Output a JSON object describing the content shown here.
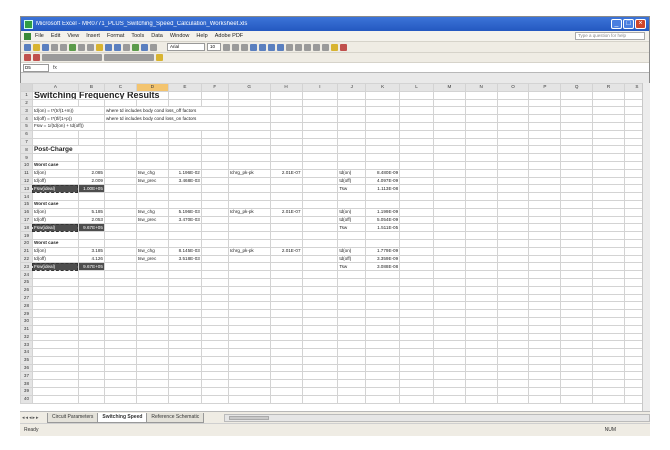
{
  "window": {
    "title": "Microsoft Excel - MR0771_PLUS_Switching_Speed_Calculation_Worksheet.xls",
    "buttons": [
      "_",
      "□",
      "×"
    ]
  },
  "menu": {
    "items": [
      "File",
      "Edit",
      "View",
      "Insert",
      "Format",
      "Tools",
      "Data",
      "Window",
      "Help",
      "Adobe PDF"
    ],
    "help_placeholder": "Type a question for help"
  },
  "toolbar": {
    "font": "Arial",
    "size": "10"
  },
  "formula_bar": {
    "cell": "D5",
    "fx": "fx",
    "value": ""
  },
  "columns": [
    "A",
    "B",
    "C",
    "D",
    "E",
    "F",
    "G",
    "H",
    "I",
    "J",
    "K",
    "L",
    "M",
    "N",
    "O",
    "P",
    "Q",
    "R",
    "S"
  ],
  "selected_column": "D",
  "sheet": {
    "title": "Switching Frequency Results",
    "notes": [
      {
        "a": "td(on) = t*(tr/(1+m))",
        "c": "where td includes body cond loss_off factors"
      },
      {
        "a": "td(off) = t*(tf/(1+p))",
        "c": "where td includes body cond loss_on factors"
      },
      {
        "a": "Fsw = 1/(td(on) + td(off))",
        "c": ""
      }
    ],
    "section": "Post-Charge",
    "groups": [
      {
        "label": "Worst case",
        "rows": [
          {
            "a": "td(on)",
            "b": "2.085",
            "d": "tsw_chg",
            "e": "1.196E-02",
            "g": "Ichrg_pk-pk",
            "h": "2.01E-07",
            "j": "td(on)",
            "k": "8.480E-09"
          },
          {
            "a": "td(off)",
            "b": "2.009",
            "d": "tsw_prec",
            "e": "3.468E-03",
            "g": "",
            "h": "",
            "j": "td(off)",
            "k": "4.097E-09"
          },
          {
            "a": "Fsw(ideal)",
            "b": "1.00E+05",
            "d": "",
            "e": "",
            "g": "",
            "h": "",
            "j": "Tsw",
            "k": "1.113E-08"
          }
        ]
      },
      {
        "label": "Worst case",
        "rows": [
          {
            "a": "td(on)",
            "b": "5.185",
            "d": "tsw_chg",
            "e": "5.196E-03",
            "g": "Ichrg_pk-pk",
            "h": "2.01E-07",
            "j": "td(on)",
            "k": "1.199E-09"
          },
          {
            "a": "td(off)",
            "b": "2.053",
            "d": "tsw_prec",
            "e": "3.470E-03",
            "g": "",
            "h": "",
            "j": "td(off)",
            "k": "5.054E-09"
          },
          {
            "a": "Fsw(ideal)",
            "b": "9.67E+05",
            "d": "",
            "e": "",
            "g": "",
            "h": "",
            "j": "Tsw",
            "k": "1.511E-05"
          }
        ]
      },
      {
        "label": "Worst case",
        "rows": [
          {
            "a": "td(on)",
            "b": "3.185",
            "d": "tsw_chg",
            "e": "8.145E-03",
            "g": "Ichrg_pk-pk",
            "h": "2.01E-07",
            "j": "td(on)",
            "k": "1.779E-09"
          },
          {
            "a": "td(off)",
            "b": "4.126",
            "d": "tsw_prec",
            "e": "3.518E-03",
            "g": "",
            "h": "",
            "j": "td(off)",
            "k": "3.359E-09"
          },
          {
            "a": "Fsw(ideal)",
            "b": "9.67E+05",
            "d": "",
            "e": "",
            "g": "",
            "h": "",
            "j": "Tsw",
            "k": "3.088E-08"
          }
        ]
      }
    ]
  },
  "tabs": [
    "Circuit Parameters",
    "Switching Speed",
    "Reference Schematic"
  ],
  "active_tab": "Switching Speed",
  "status": {
    "left": "Ready",
    "right": "NUM"
  }
}
